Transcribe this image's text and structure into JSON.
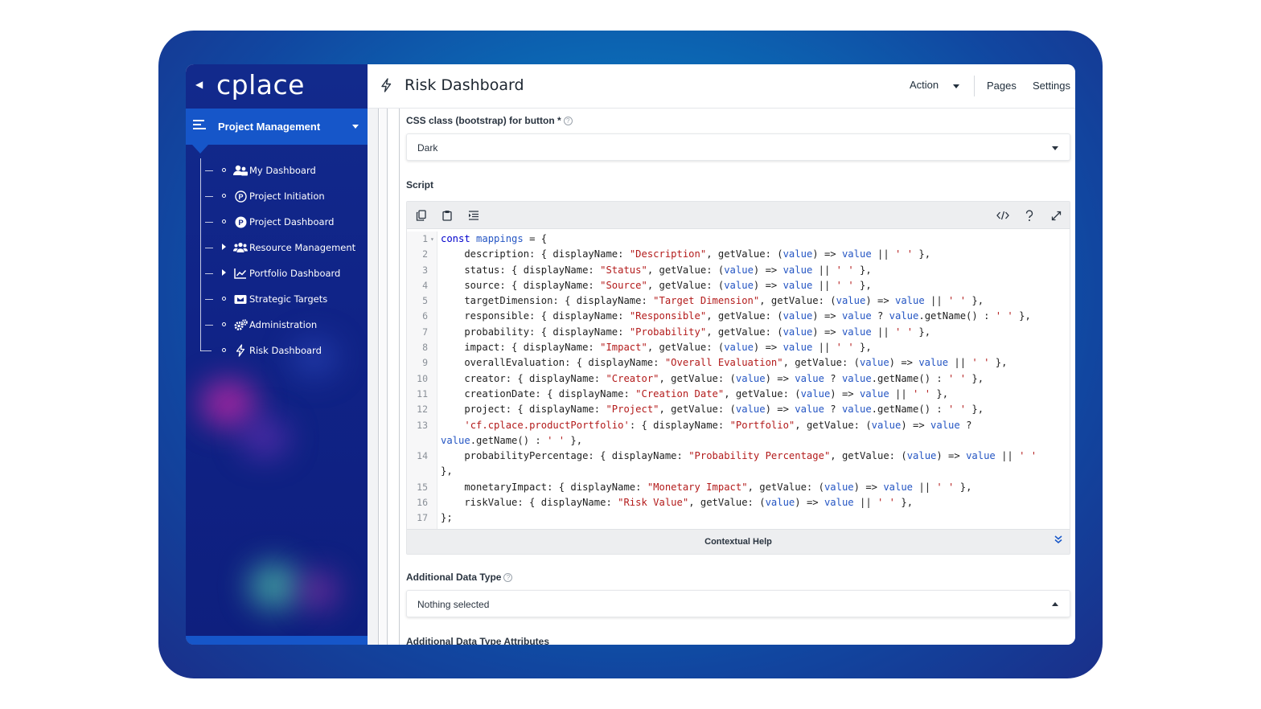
{
  "app": {
    "logo": "cplace",
    "page_title": "Risk Dashboard"
  },
  "header": {
    "action_label": "Action",
    "pages_label": "Pages",
    "settings_label": "Settings"
  },
  "sidebar": {
    "section_label": "Project Management",
    "items": [
      {
        "label": "My Dashboard",
        "icon": "user-group-icon",
        "expandable": false
      },
      {
        "label": "Project Initiation",
        "icon": "circled-p-outline-icon",
        "expandable": false
      },
      {
        "label": "Project Dashboard",
        "icon": "circled-p-filled-icon",
        "expandable": false
      },
      {
        "label": "Resource Management",
        "icon": "people-icon",
        "expandable": true
      },
      {
        "label": "Portfolio Dashboard",
        "icon": "line-chart-icon",
        "expandable": true
      },
      {
        "label": "Strategic Targets",
        "icon": "target-icon",
        "expandable": false
      },
      {
        "label": "Administration",
        "icon": "gears-icon",
        "expandable": false
      },
      {
        "label": "Risk Dashboard",
        "icon": "bolt-icon",
        "expandable": false
      }
    ]
  },
  "form": {
    "css_class_label": "CSS class (bootstrap) for button *",
    "css_class_value": "Dark",
    "script_label": "Script",
    "contextual_help_label": "Contextual Help",
    "additional_data_type_label": "Additional Data Type",
    "additional_data_type_value": "Nothing selected",
    "additional_data_type_attributes_label": "Additional Data Type Attributes"
  },
  "editor": {
    "lines": [
      {
        "n": "1",
        "fold": true
      },
      {
        "n": "2"
      },
      {
        "n": "3"
      },
      {
        "n": "4"
      },
      {
        "n": "5"
      },
      {
        "n": "6"
      },
      {
        "n": "7"
      },
      {
        "n": "8"
      },
      {
        "n": "9"
      },
      {
        "n": "10"
      },
      {
        "n": "11"
      },
      {
        "n": "12"
      },
      {
        "n": "13"
      },
      {
        "n": ""
      },
      {
        "n": "14"
      },
      {
        "n": ""
      },
      {
        "n": "15"
      },
      {
        "n": "16"
      },
      {
        "n": "17"
      }
    ],
    "tokens": [
      [
        [
          "kw",
          "const"
        ],
        [
          "p",
          " "
        ],
        [
          "v",
          "mappings"
        ],
        [
          "p",
          " = {"
        ]
      ],
      [
        [
          "p",
          "    description: { displayName: "
        ],
        [
          "s",
          "\"Description\""
        ],
        [
          "p",
          ", getValue: ("
        ],
        [
          "v",
          "value"
        ],
        [
          "p",
          ") => "
        ],
        [
          "v",
          "value"
        ],
        [
          "p",
          " || "
        ],
        [
          "s",
          "' '"
        ],
        [
          "p",
          " },"
        ]
      ],
      [
        [
          "p",
          "    status: { displayName: "
        ],
        [
          "s",
          "\"Status\""
        ],
        [
          "p",
          ", getValue: ("
        ],
        [
          "v",
          "value"
        ],
        [
          "p",
          ") => "
        ],
        [
          "v",
          "value"
        ],
        [
          "p",
          " || "
        ],
        [
          "s",
          "' '"
        ],
        [
          "p",
          " },"
        ]
      ],
      [
        [
          "p",
          "    source: { displayName: "
        ],
        [
          "s",
          "\"Source\""
        ],
        [
          "p",
          ", getValue: ("
        ],
        [
          "v",
          "value"
        ],
        [
          "p",
          ") => "
        ],
        [
          "v",
          "value"
        ],
        [
          "p",
          " || "
        ],
        [
          "s",
          "' '"
        ],
        [
          "p",
          " },"
        ]
      ],
      [
        [
          "p",
          "    targetDimension: { displayName: "
        ],
        [
          "s",
          "\"Target Dimension\""
        ],
        [
          "p",
          ", getValue: ("
        ],
        [
          "v",
          "value"
        ],
        [
          "p",
          ") => "
        ],
        [
          "v",
          "value"
        ],
        [
          "p",
          " || "
        ],
        [
          "s",
          "' '"
        ],
        [
          "p",
          " },"
        ]
      ],
      [
        [
          "p",
          "    responsible: { displayName: "
        ],
        [
          "s",
          "\"Responsible\""
        ],
        [
          "p",
          ", getValue: ("
        ],
        [
          "v",
          "value"
        ],
        [
          "p",
          ") => "
        ],
        [
          "v",
          "value"
        ],
        [
          "p",
          " ? "
        ],
        [
          "v",
          "value"
        ],
        [
          "p",
          ".getName() : "
        ],
        [
          "s",
          "' '"
        ],
        [
          "p",
          " },"
        ]
      ],
      [
        [
          "p",
          "    probability: { displayName: "
        ],
        [
          "s",
          "\"Probability\""
        ],
        [
          "p",
          ", getValue: ("
        ],
        [
          "v",
          "value"
        ],
        [
          "p",
          ") => "
        ],
        [
          "v",
          "value"
        ],
        [
          "p",
          " || "
        ],
        [
          "s",
          "' '"
        ],
        [
          "p",
          " },"
        ]
      ],
      [
        [
          "p",
          "    impact: { displayName: "
        ],
        [
          "s",
          "\"Impact\""
        ],
        [
          "p",
          ", getValue: ("
        ],
        [
          "v",
          "value"
        ],
        [
          "p",
          ") => "
        ],
        [
          "v",
          "value"
        ],
        [
          "p",
          " || "
        ],
        [
          "s",
          "' '"
        ],
        [
          "p",
          " },"
        ]
      ],
      [
        [
          "p",
          "    overallEvaluation: { displayName: "
        ],
        [
          "s",
          "\"Overall Evaluation\""
        ],
        [
          "p",
          ", getValue: ("
        ],
        [
          "v",
          "value"
        ],
        [
          "p",
          ") => "
        ],
        [
          "v",
          "value"
        ],
        [
          "p",
          " || "
        ],
        [
          "s",
          "' '"
        ],
        [
          "p",
          " },"
        ]
      ],
      [
        [
          "p",
          "    creator: { displayName: "
        ],
        [
          "s",
          "\"Creator\""
        ],
        [
          "p",
          ", getValue: ("
        ],
        [
          "v",
          "value"
        ],
        [
          "p",
          ") => "
        ],
        [
          "v",
          "value"
        ],
        [
          "p",
          " ? "
        ],
        [
          "v",
          "value"
        ],
        [
          "p",
          ".getName() : "
        ],
        [
          "s",
          "' '"
        ],
        [
          "p",
          " },"
        ]
      ],
      [
        [
          "p",
          "    creationDate: { displayName: "
        ],
        [
          "s",
          "\"Creation Date\""
        ],
        [
          "p",
          ", getValue: ("
        ],
        [
          "v",
          "value"
        ],
        [
          "p",
          ") => "
        ],
        [
          "v",
          "value"
        ],
        [
          "p",
          " || "
        ],
        [
          "s",
          "' '"
        ],
        [
          "p",
          " },"
        ]
      ],
      [
        [
          "p",
          "    project: { displayName: "
        ],
        [
          "s",
          "\"Project\""
        ],
        [
          "p",
          ", getValue: ("
        ],
        [
          "v",
          "value"
        ],
        [
          "p",
          ") => "
        ],
        [
          "v",
          "value"
        ],
        [
          "p",
          " ? "
        ],
        [
          "v",
          "value"
        ],
        [
          "p",
          ".getName() : "
        ],
        [
          "s",
          "' '"
        ],
        [
          "p",
          " },"
        ]
      ],
      [
        [
          "p",
          "    "
        ],
        [
          "s",
          "'cf.cplace.productPortfolio'"
        ],
        [
          "p",
          ": { displayName: "
        ],
        [
          "s",
          "\"Portfolio\""
        ],
        [
          "p",
          ", getValue: ("
        ],
        [
          "v",
          "value"
        ],
        [
          "p",
          ") => "
        ],
        [
          "v",
          "value"
        ],
        [
          "p",
          " ?"
        ]
      ],
      [
        [
          "v",
          "value"
        ],
        [
          "p",
          ".getName() : "
        ],
        [
          "s",
          "' '"
        ],
        [
          "p",
          " },"
        ]
      ],
      [
        [
          "p",
          "    probabilityPercentage: { displayName: "
        ],
        [
          "s",
          "\"Probability Percentage\""
        ],
        [
          "p",
          ", getValue: ("
        ],
        [
          "v",
          "value"
        ],
        [
          "p",
          ") => "
        ],
        [
          "v",
          "value"
        ],
        [
          "p",
          " || "
        ],
        [
          "s",
          "' '"
        ]
      ],
      [
        [
          "p",
          "},"
        ]
      ],
      [
        [
          "p",
          "    monetaryImpact: { displayName: "
        ],
        [
          "s",
          "\"Monetary Impact\""
        ],
        [
          "p",
          ", getValue: ("
        ],
        [
          "v",
          "value"
        ],
        [
          "p",
          ") => "
        ],
        [
          "v",
          "value"
        ],
        [
          "p",
          " || "
        ],
        [
          "s",
          "' '"
        ],
        [
          "p",
          " },"
        ]
      ],
      [
        [
          "p",
          "    riskValue: { displayName: "
        ],
        [
          "s",
          "\"Risk Value\""
        ],
        [
          "p",
          ", getValue: ("
        ],
        [
          "v",
          "value"
        ],
        [
          "p",
          ") => "
        ],
        [
          "v",
          "value"
        ],
        [
          "p",
          " || "
        ],
        [
          "s",
          "' '"
        ],
        [
          "p",
          " },"
        ]
      ],
      [
        [
          "p",
          "};"
        ]
      ]
    ]
  },
  "toolbar_icons": [
    "copy-icon",
    "paste-icon",
    "indent-icon",
    "code-icon",
    "help-icon",
    "fullscreen-icon"
  ],
  "colors": {
    "sidebar_bg": "#102387",
    "section_bg": "#1656c9",
    "string": "#b31b1b",
    "keyword": "#0000cc",
    "variable": "#2455c3"
  }
}
